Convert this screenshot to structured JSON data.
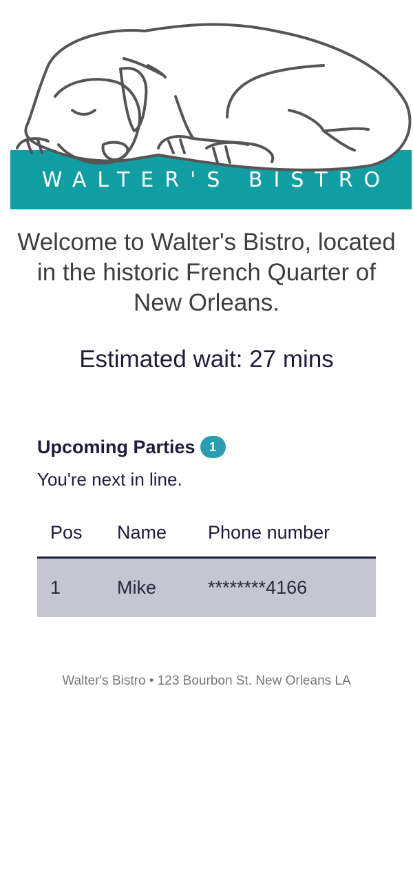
{
  "brand": {
    "name": "WALTER'S BISTRO",
    "teal": "#119ea3",
    "icon": "sleeping-dog-logo"
  },
  "welcome": "Welcome to Walter's Bistro, located in the historic French Quarter of New Orleans.",
  "wait": "Estimated wait: 27 mins",
  "parties": {
    "heading": "Upcoming Parties",
    "count": "1",
    "status": "You're next in line.",
    "columns": [
      "Pos",
      "Name",
      "Phone number"
    ],
    "rows": [
      {
        "pos": "1",
        "name": "Mike",
        "phone": "********4166"
      }
    ]
  },
  "footer": "Walter's Bistro • 123 Bourbon St. New Orleans LA",
  "colors": {
    "accent": "#2a9db0",
    "highlight_row": "#c5c6d4",
    "navy": "#1d1c3a"
  }
}
